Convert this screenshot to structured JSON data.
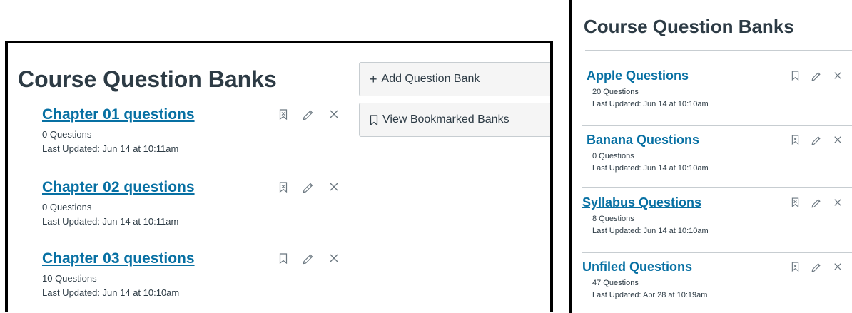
{
  "left_panel": {
    "title": "Course Question Banks",
    "add_button_label": "Add Question Bank",
    "add_button_glyph": "+",
    "view_button_label": "View Bookmarked Banks",
    "banks": [
      {
        "name": "Chapter 01 questions",
        "count": "0 Questions",
        "updated": "Last Updated: Jun 14 at 10:11am",
        "bookmarked": false
      },
      {
        "name": "Chapter 02 questions",
        "count": "0 Questions",
        "updated": "Last Updated: Jun 14 at 10:11am",
        "bookmarked": false
      },
      {
        "name": "Chapter 03 questions",
        "count": "10 Questions",
        "updated": "Last Updated: Jun 14 at 10:10am",
        "bookmarked": true
      }
    ]
  },
  "right_panel": {
    "title": "Course Question Banks",
    "banks": [
      {
        "name": "Apple Questions",
        "count": "20 Questions",
        "updated": "Last Updated: Jun 14 at 10:10am",
        "bookmarked": true
      },
      {
        "name": "Banana Questions",
        "count": "0 Questions",
        "updated": "Last Updated: Jun 14 at 10:10am",
        "bookmarked": false
      },
      {
        "name": "Syllabus Questions",
        "count": "8 Questions",
        "updated": "Last Updated: Jun 14 at 10:10am",
        "bookmarked": false
      },
      {
        "name": "Unfiled Questions",
        "count": "47 Questions",
        "updated": "Last Updated: Apr 28 at 10:19am",
        "bookmarked": false
      }
    ]
  },
  "icons": {
    "bookmark": "bookmark-icon",
    "unbookmark": "bookmark-x-icon",
    "edit": "pencil-icon",
    "delete": "close-icon"
  },
  "colors": {
    "link": "#0770a3",
    "text": "#2d3b45",
    "icon": "#6b7780",
    "rule": "#c7cdd1",
    "button_bg": "#f5f5f5"
  }
}
